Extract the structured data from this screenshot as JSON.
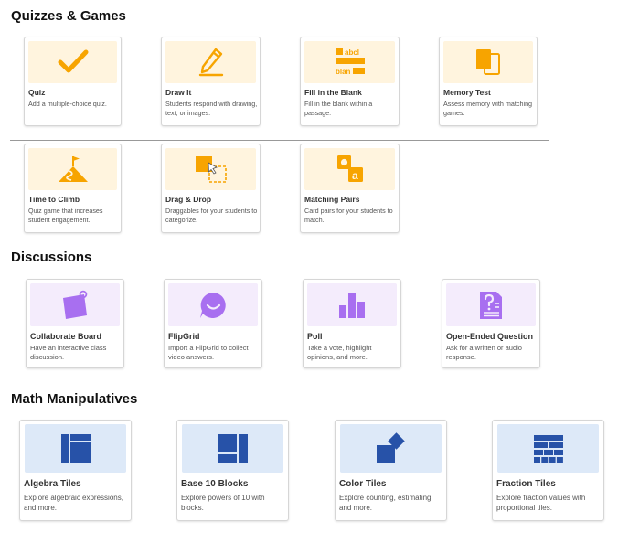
{
  "sections": {
    "quizzes": {
      "title": "Quizzes & Games",
      "cards": [
        {
          "title": "Quiz",
          "desc": "Add a multiple-choice quiz.",
          "icon": "checkmark-icon"
        },
        {
          "title": "Draw It",
          "desc": "Students respond with drawing, text, or images.",
          "icon": "pencil-icon"
        },
        {
          "title": "Fill in the Blank",
          "desc": "Fill in the blank within a passage.",
          "icon": "fill-blank-icon",
          "icon_text": [
            "abcl",
            "blan"
          ]
        },
        {
          "title": "Memory Test",
          "desc": "Assess memory with matching games.",
          "icon": "memory-cards-icon"
        },
        {
          "title": "Time to Climb",
          "desc": "Quiz game that increases student engagement.",
          "icon": "mountain-flag-icon"
        },
        {
          "title": "Drag & Drop",
          "desc": "Draggables for your students to categorize.",
          "icon": "drag-drop-icon"
        },
        {
          "title": "Matching Pairs",
          "desc": "Card pairs for your students to match.",
          "icon": "matching-pairs-icon",
          "icon_text": "a"
        }
      ]
    },
    "discussions": {
      "title": "Discussions",
      "cards": [
        {
          "title": "Collaborate Board",
          "desc": "Have an interactive class discussion.",
          "icon": "pinned-note-icon"
        },
        {
          "title": "FlipGrid",
          "desc": "Import a FlipGrid to collect video answers.",
          "icon": "flipgrid-icon"
        },
        {
          "title": "Poll",
          "desc": "Take a vote, highlight opinions, and more.",
          "icon": "bar-chart-icon"
        },
        {
          "title": "Open-Ended Question",
          "desc": "Ask for a written or audio response.",
          "icon": "question-document-icon"
        }
      ]
    },
    "math": {
      "title": "Math Manipulatives",
      "cards": [
        {
          "title": "Algebra Tiles",
          "desc": "Explore algebraic expressions, and more.",
          "icon": "algebra-tiles-icon"
        },
        {
          "title": "Base 10 Blocks",
          "desc": "Explore powers of 10 with blocks.",
          "icon": "base10-blocks-icon"
        },
        {
          "title": "Color Tiles",
          "desc": "Explore counting, estimating, and more.",
          "icon": "color-tiles-icon"
        },
        {
          "title": "Fraction Tiles",
          "desc": "Explore fraction values with proportional tiles.",
          "icon": "fraction-tiles-icon"
        }
      ]
    }
  },
  "colors": {
    "yellow_icon": "#f7a400",
    "yellow_bg": "#fff4de",
    "purple_icon": "#a86ff0",
    "purple_bg": "#f4ecfc",
    "blue_icon": "#2752a8",
    "blue_bg": "#dde9f8"
  }
}
